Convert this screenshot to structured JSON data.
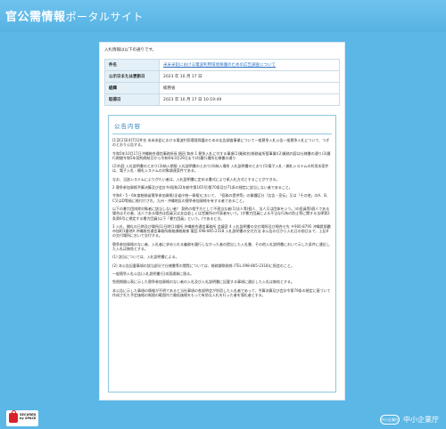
{
  "header": {
    "site_title": "官公需情報",
    "site_subtitle": "ポータルサイト"
  },
  "intro_text": "入札情報は以下の通りです。",
  "info_table": [
    {
      "label": "件名",
      "value": "米米米鉛における電波利用環境保護のための広告調査について",
      "is_link": true
    },
    {
      "label": "公示日または更新日",
      "value": "2023 年 10 月 17 日",
      "is_link": false
    },
    {
      "label": "組織",
      "value": "総務省",
      "is_link": false
    },
    {
      "label": "取得日",
      "value": "2023 年 10 月 17 日 10:19:49",
      "is_link": false
    }
  ],
  "notice": {
    "title": "公告内容",
    "paragraphs": [
      "[1]2[2]3[4]7[1]件名 米米米鉛における電波利用環境保護のための広告調査事業について一般競争入札公告一般競争入札について、つぎのとおり公告する。",
      "令和5年10月17日沖縄総合通信事務所長 植田 和彦 1 競争入札に付する事項(1)業務名(総務省所管事業)(2)業務内容は仕様書の通り(3)履行期間令和5年契約締結日から令和6年3月29日まで(4)履行場所仕様書の通り",
      "(2)内容 入札説明書のとおり(3)納入期限 入札説明書のとおり(4)納入場所 入札説明書のとおり(5)電子入札・開札システムの利用本案件は、電子入札・開札システムの対象調達案件である。",
      "なお、当該システムによりがたい者は、入札説明書に定める書式により紙入札方式とすることができる。",
      "2 競争参加資格予算決算及び会計令(昭和22年勅令第165号)第70条及び71条の規定に該当しない者であること。",
      "令和4・5・6年度総務省競争参加資格(全省庁統一資格)において、「役務の提供等」の業種区分「広告・宣伝」又は「その他」のA、B、C又はD等級に格付けされ、九州・沖縄地区の競争参加資格を有する者であること。",
      "以下の暴力団排除対象者に該当しない者？ 契約の相手方として不適当な者(1)法人等(個人、法人又は団体をいう。)の役員等(個人である場合はその者、法人である場合は役員又は支店若しくは営業所の代表者をいう。)が暴力団員による不当な行為の防止等に関する法律第2条第6号に規定する暴力団員(以下「暴力団員」という。)であるとき。",
      "3 入札、開札の日時及び場所(1)日時(1)場所 沖縄総合通信事務所 会議室 4 入札説明書の交付場所及び問合せ先 〒900-8795 沖縄県那覇市旭町1番地9 沖縄総合通信事務所総務課総務係 電話 098-865-2318 入札説明書の交付方法 本公告の日から入札日の前日まで、上記4の交付場所において交付する。",
      "競争参加資格のない者、入札者に求められる義務を履行しなかった者の提出した入札書、その他入札説明書において示した条件に違反した入札は無効とする。",
      "(1) 該当については、入札説明書による。",
      "(2) 本公告記載事項の該当部分で仕様書等の閲覧については、総務課財務係 (TEL.098-865-2318)に照会のこと。",
      "一般競争入札公告(入札説明書)日本国通貨に限る。",
      "免税期間公表に示した競争参加資格のない者の入札及び入札説明書に記載する事項に違反した入札は無効とする。",
      "本公告に示した事項の情報が不明であると当社事項の各説明会が利用した入札者であって、予算決算及び会計令第79条の規定に基づいて作成された予定価格の制限の範囲内で最低価格をもって有効な入札を行った者を落札者とする。"
    ]
  },
  "footer": {
    "seal_line1": "SECURED",
    "seal_line2": "by SPACE",
    "agency_mark": "中小企業庁",
    "agency_name": "中小企業庁"
  }
}
